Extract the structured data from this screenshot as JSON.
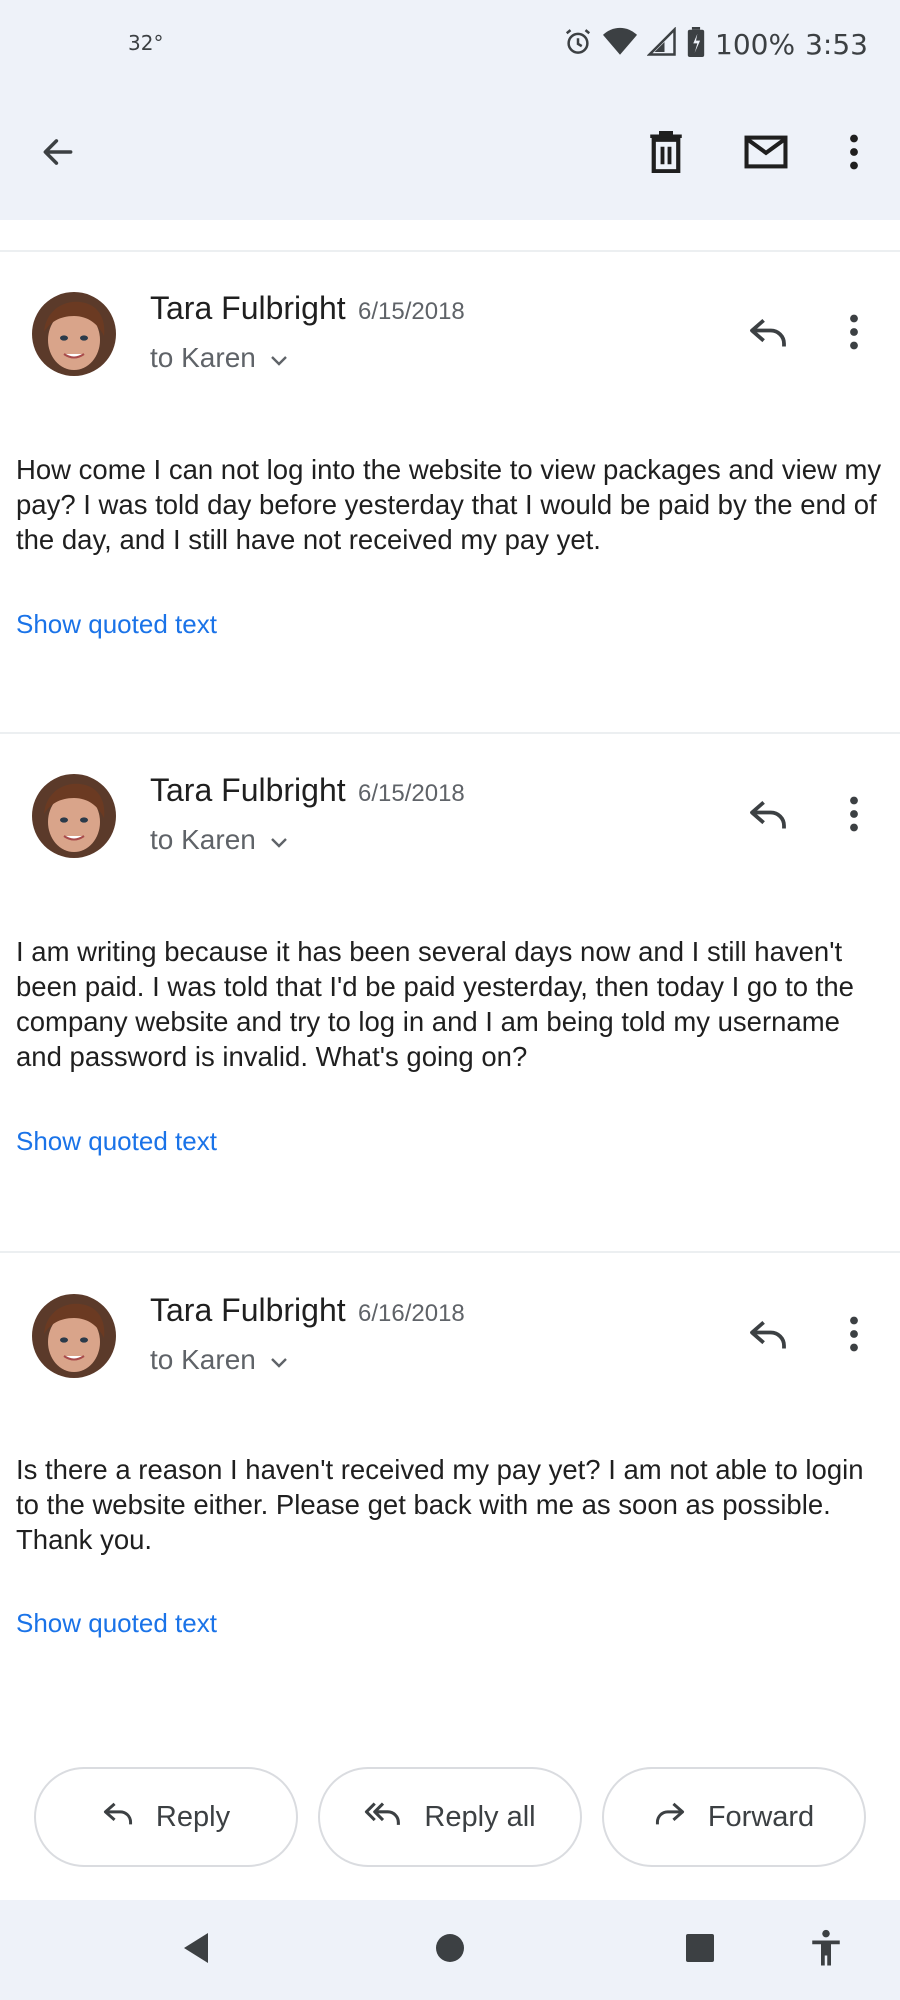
{
  "status_bar": {
    "temperature": "32°",
    "battery": "100%",
    "time": "3:53",
    "icons": [
      "alarm-icon",
      "wifi-icon",
      "signal-icon",
      "battery-icon"
    ]
  },
  "app_bar": {
    "icons": [
      "back-arrow-icon",
      "delete-icon",
      "mark-unread-icon",
      "more-vert-icon"
    ]
  },
  "messages": [
    {
      "sender": "Tara Fulbright",
      "date": "6/15/2018",
      "recipient": "to Karen",
      "body": "How come I can not log into the website to view packages and view my pay? I was told day before yesterday that I would be paid by the end of the day, and I still have not received my pay yet.",
      "quoted_link": "Show quoted text"
    },
    {
      "sender": "Tara Fulbright",
      "date": "6/15/2018",
      "recipient": "to Karen",
      "body": "I am writing because it has been several days now and I still haven't been paid.  I was told that I'd be paid yesterday,  then today I go to the company website and try to log in and I am being told my username and password is invalid. What's going on?",
      "quoted_link": "Show quoted text"
    },
    {
      "sender": "Tara Fulbright",
      "date": "6/16/2018",
      "recipient": "to Karen",
      "body": "Is there a reason I haven't received my pay yet? I am not able to login to the website either. Please get back with me as soon as possible. Thank you.",
      "quoted_link": "Show quoted text"
    }
  ],
  "actions": {
    "reply": "Reply",
    "reply_all": "Reply all",
    "forward": "Forward"
  },
  "colors": {
    "link": "#1a73e8",
    "app_bar_bg": "#eef2f9"
  }
}
